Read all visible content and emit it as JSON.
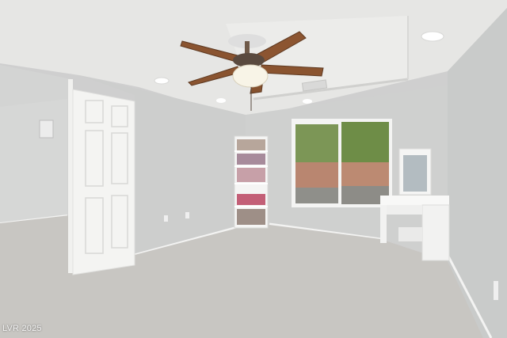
{
  "photo": {
    "watermark": "LVR 2025",
    "description_elements": [
      "ceiling-fan",
      "open-door",
      "bookshelf",
      "window",
      "vanity-desk",
      "carpet"
    ]
  },
  "colors": {
    "wall": "#cfd0cf",
    "wall_shadow": "#bfc1c0",
    "ceiling": "#e9e9e8",
    "carpet": "#c9c7c3",
    "door": "#f3f3f1",
    "trim": "#f6f6f5",
    "fan_blade": "#8a5430",
    "window_tree": "#6f8f45",
    "window_fence": "#b9826a"
  }
}
